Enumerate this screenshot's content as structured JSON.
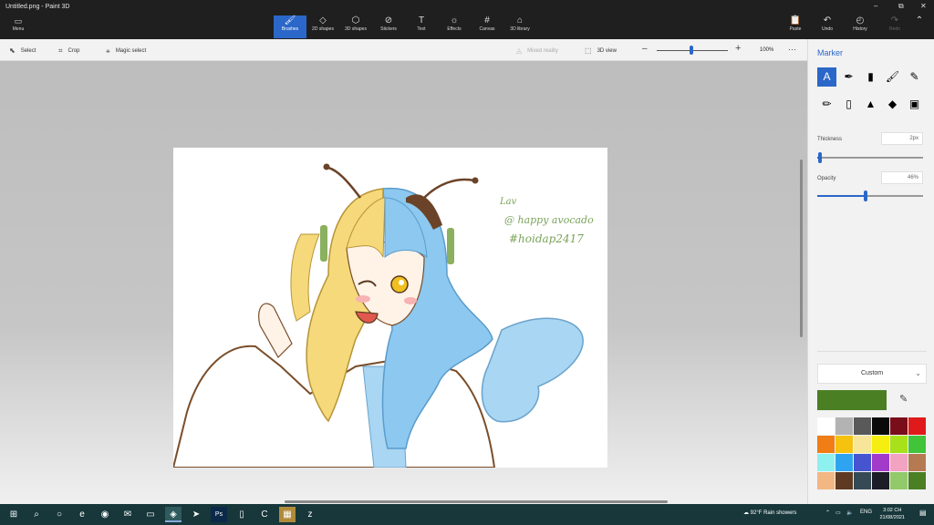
{
  "app": {
    "title": "Untitled.png - Paint 3D",
    "window_controls": [
      "–",
      "⧉",
      "✕"
    ]
  },
  "ribbon": {
    "menu_label": "Menu",
    "tools": [
      {
        "label": "Brushes",
        "icon": "brush-icon",
        "glyph": "🖌",
        "active": true
      },
      {
        "label": "2D shapes",
        "icon": "2d-shapes-icon",
        "glyph": "◇",
        "active": false
      },
      {
        "label": "3D shapes",
        "icon": "3d-shapes-icon",
        "glyph": "⬡",
        "active": false
      },
      {
        "label": "Stickers",
        "icon": "stickers-icon",
        "glyph": "⊘",
        "active": false
      },
      {
        "label": "Text",
        "icon": "text-icon",
        "glyph": "T",
        "active": false
      },
      {
        "label": "Effects",
        "icon": "effects-icon",
        "glyph": "☼",
        "active": false
      },
      {
        "label": "Canvas",
        "icon": "canvas-icon",
        "glyph": "#",
        "active": false
      },
      {
        "label": "3D library",
        "icon": "3d-library-icon",
        "glyph": "⌂",
        "active": false
      }
    ],
    "paste_label": "Paste",
    "undo_label": "Undo",
    "history_label": "History",
    "redo_label": "Redo"
  },
  "subbar": {
    "select_label": "Select",
    "crop_label": "Crop",
    "magic_select_label": "Magic select",
    "mixed_reality_label": "Mixed reality",
    "view3d_label": "3D view",
    "zoom_value": "100%",
    "more": "⋯"
  },
  "canvas": {
    "watermark_line1": "@ happy avocado",
    "watermark_line2": "#hoidap2417",
    "signature": "Lav"
  },
  "panel": {
    "title": "Marker",
    "brushes": [
      {
        "name": "marker-brush",
        "glyph": "A",
        "selected": true
      },
      {
        "name": "calligraphy-pen-brush",
        "glyph": "✒",
        "selected": false
      },
      {
        "name": "oil-brush",
        "glyph": "▮",
        "selected": false
      },
      {
        "name": "watercolor-brush",
        "glyph": "🖌",
        "selected": false
      },
      {
        "name": "pixel-pen-brush",
        "glyph": "✎",
        "selected": false
      },
      {
        "name": "pencil-brush",
        "glyph": "✏",
        "selected": false
      },
      {
        "name": "eraser-brush",
        "glyph": "▯",
        "selected": false
      },
      {
        "name": "crayon-brush",
        "glyph": "▲",
        "selected": false
      },
      {
        "name": "spray-can-brush",
        "glyph": "◆",
        "selected": false
      },
      {
        "name": "fill-brush",
        "glyph": "▣",
        "selected": false
      }
    ],
    "thickness_label": "Thickness",
    "thickness_value": "2px",
    "thickness_fraction": 0.03,
    "opacity_label": "Opacity",
    "opacity_value": "46%",
    "opacity_fraction": 0.46,
    "color_mode": "Custom",
    "current_color": "#4a7f24",
    "swatches": [
      "#ffffff",
      "#b3b3b3",
      "#595959",
      "#0a0a0a",
      "#7a0d1a",
      "#e01a1a",
      "#f07d16",
      "#f5c20f",
      "#f7e69a",
      "#f6ee10",
      "#a8e11a",
      "#41c33a",
      "#8ff0f0",
      "#2ea4f0",
      "#4655cf",
      "#a23bc9",
      "#f2a3c2",
      "#b57a52",
      "#f3b784",
      "#5e3a22",
      "#364a55",
      "#1c1d26",
      "#92c96b",
      "#4a7f24"
    ]
  },
  "taskbar": {
    "weather": "92°F  Rain showers",
    "lang": "ENG",
    "time": "3:02 CH",
    "date": "21/08/2021",
    "apps": [
      {
        "name": "start-icon",
        "glyph": "⊞"
      },
      {
        "name": "search-icon",
        "glyph": "⌕"
      },
      {
        "name": "task-view-icon",
        "glyph": "○"
      },
      {
        "name": "edge-icon",
        "glyph": "e"
      },
      {
        "name": "firefox-icon",
        "glyph": "◉"
      },
      {
        "name": "mail-icon",
        "glyph": "✉"
      },
      {
        "name": "file-explorer-icon",
        "glyph": "▭"
      },
      {
        "name": "paint3d-icon",
        "glyph": "◈"
      },
      {
        "name": "telegram-icon",
        "glyph": "➤"
      },
      {
        "name": "photoshop-icon",
        "glyph": "Ps"
      },
      {
        "name": "notepad-icon",
        "glyph": "▯"
      },
      {
        "name": "camtasia-icon",
        "glyph": "C"
      },
      {
        "name": "store-icon",
        "glyph": "▦"
      },
      {
        "name": "zalo-icon",
        "glyph": "z"
      }
    ]
  }
}
